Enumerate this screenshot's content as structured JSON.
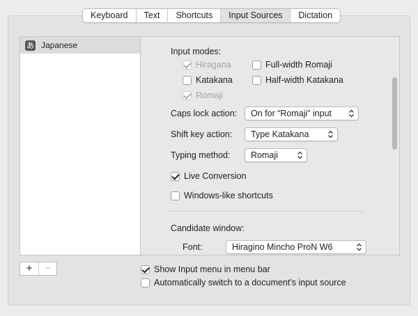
{
  "tabs": [
    "Keyboard",
    "Text",
    "Shortcuts",
    "Input Sources",
    "Dictation"
  ],
  "selected_tab": "Input Sources",
  "sources": [
    {
      "icon": "あ",
      "label": "Japanese"
    }
  ],
  "input_modes": {
    "heading": "Input modes:",
    "hiragana": "Hiragana",
    "katakana": "Katakana",
    "romaji": "Romaji",
    "full_width_romaji": "Full-width Romaji",
    "half_width_katakana": "Half-width Katakana"
  },
  "caps_lock": {
    "label": "Caps lock action:",
    "value": "On for “Romaji” input"
  },
  "shift_key": {
    "label": "Shift key action:",
    "value": "Type Katakana"
  },
  "typing_method": {
    "label": "Typing method:",
    "value": "Romaji"
  },
  "live_conversion": "Live Conversion",
  "windows_shortcuts": "Windows-like shortcuts",
  "candidate_window": {
    "heading": "Candidate window:",
    "font_label": "Font:",
    "font_value": "Hiragino Mincho ProN W6"
  },
  "bottom": {
    "add": "+",
    "remove": "−",
    "show_input_menu": "Show Input menu in menu bar",
    "auto_switch": "Automatically switch to a document’s input source"
  }
}
